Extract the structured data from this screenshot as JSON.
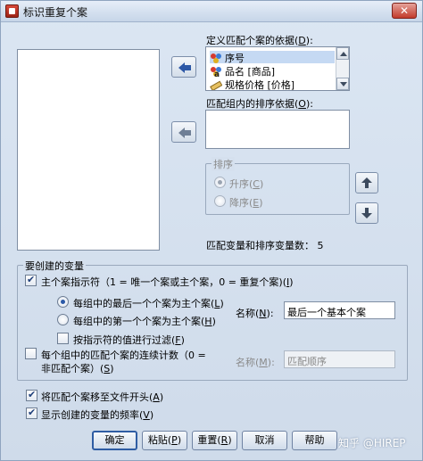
{
  "window": {
    "title": "标识重复个案",
    "close_glyph": "✕"
  },
  "colors": {
    "accent": "#2f5da3",
    "window_bg": "#d5e0ee",
    "selection": "#c5d9f3"
  },
  "source_list": {
    "items": []
  },
  "match_vars": {
    "label": "定义匹配个案的依据(",
    "key": "D",
    "label_end": "):",
    "items": [
      {
        "name": "序号",
        "icon": "nominal-icon"
      },
      {
        "name": "品名 [商品]",
        "icon": "string-nominal-icon"
      },
      {
        "name": "规格价格 [价格]",
        "icon": "scale-icon"
      }
    ]
  },
  "sort_vars": {
    "label": "匹配组内的排序依据(",
    "key": "O",
    "label_end": "):",
    "items": []
  },
  "sort_order": {
    "title": "排序",
    "ascending": {
      "label": "升序(",
      "key": "C",
      "end": ")",
      "selected": true
    },
    "descending": {
      "label": "降序(",
      "key": "E",
      "end": ")",
      "selected": false
    }
  },
  "match_count": {
    "label": "匹配变量和排序变量数：",
    "value": "5"
  },
  "create_vars": {
    "title": "要创建的变量",
    "primary_indicator": {
      "label": "主个案指示符（1 = 唯一个案或主个案，0 = 重复个案)(",
      "key": "I",
      "end": ")",
      "checked": true
    },
    "last_case": {
      "label": "每组中的最后一个个案为主个案(",
      "key": "L",
      "end": ")",
      "selected": true
    },
    "first_case": {
      "label": "每组中的第一个个案为主个案(",
      "key": "H",
      "end": ")",
      "selected": false
    },
    "filter_by_value": {
      "label": "按指示符的值进行过滤(",
      "key": "F",
      "end": ")",
      "checked": false
    },
    "name_label": "名称(",
    "name_key": "N",
    "name_end": "):",
    "name_value": "最后一个基本个案",
    "sequential_count": {
      "line1": "每个组中的匹配个案的连续计数（0 =",
      "line2": "非匹配个案）(",
      "key": "S",
      "end": ")",
      "checked": false
    },
    "name2_label": "名称(",
    "name2_key": "M",
    "name2_end": "):",
    "name2_value": "匹配顺序"
  },
  "options": {
    "move_to_top": {
      "label": "将匹配个案移至文件开头(",
      "key": "A",
      "end": ")",
      "checked": true
    },
    "show_freq": {
      "label": "显示创建的变量的频率(",
      "key": "V",
      "end": ")",
      "checked": true
    }
  },
  "buttons": {
    "ok": "确定",
    "paste": "粘贴(",
    "paste_key": "P",
    "paste_end": ")",
    "reset": "重置(",
    "reset_key": "R",
    "reset_end": ")",
    "cancel": "取消",
    "help": "帮助"
  },
  "watermark": "知乎 @HIREP"
}
